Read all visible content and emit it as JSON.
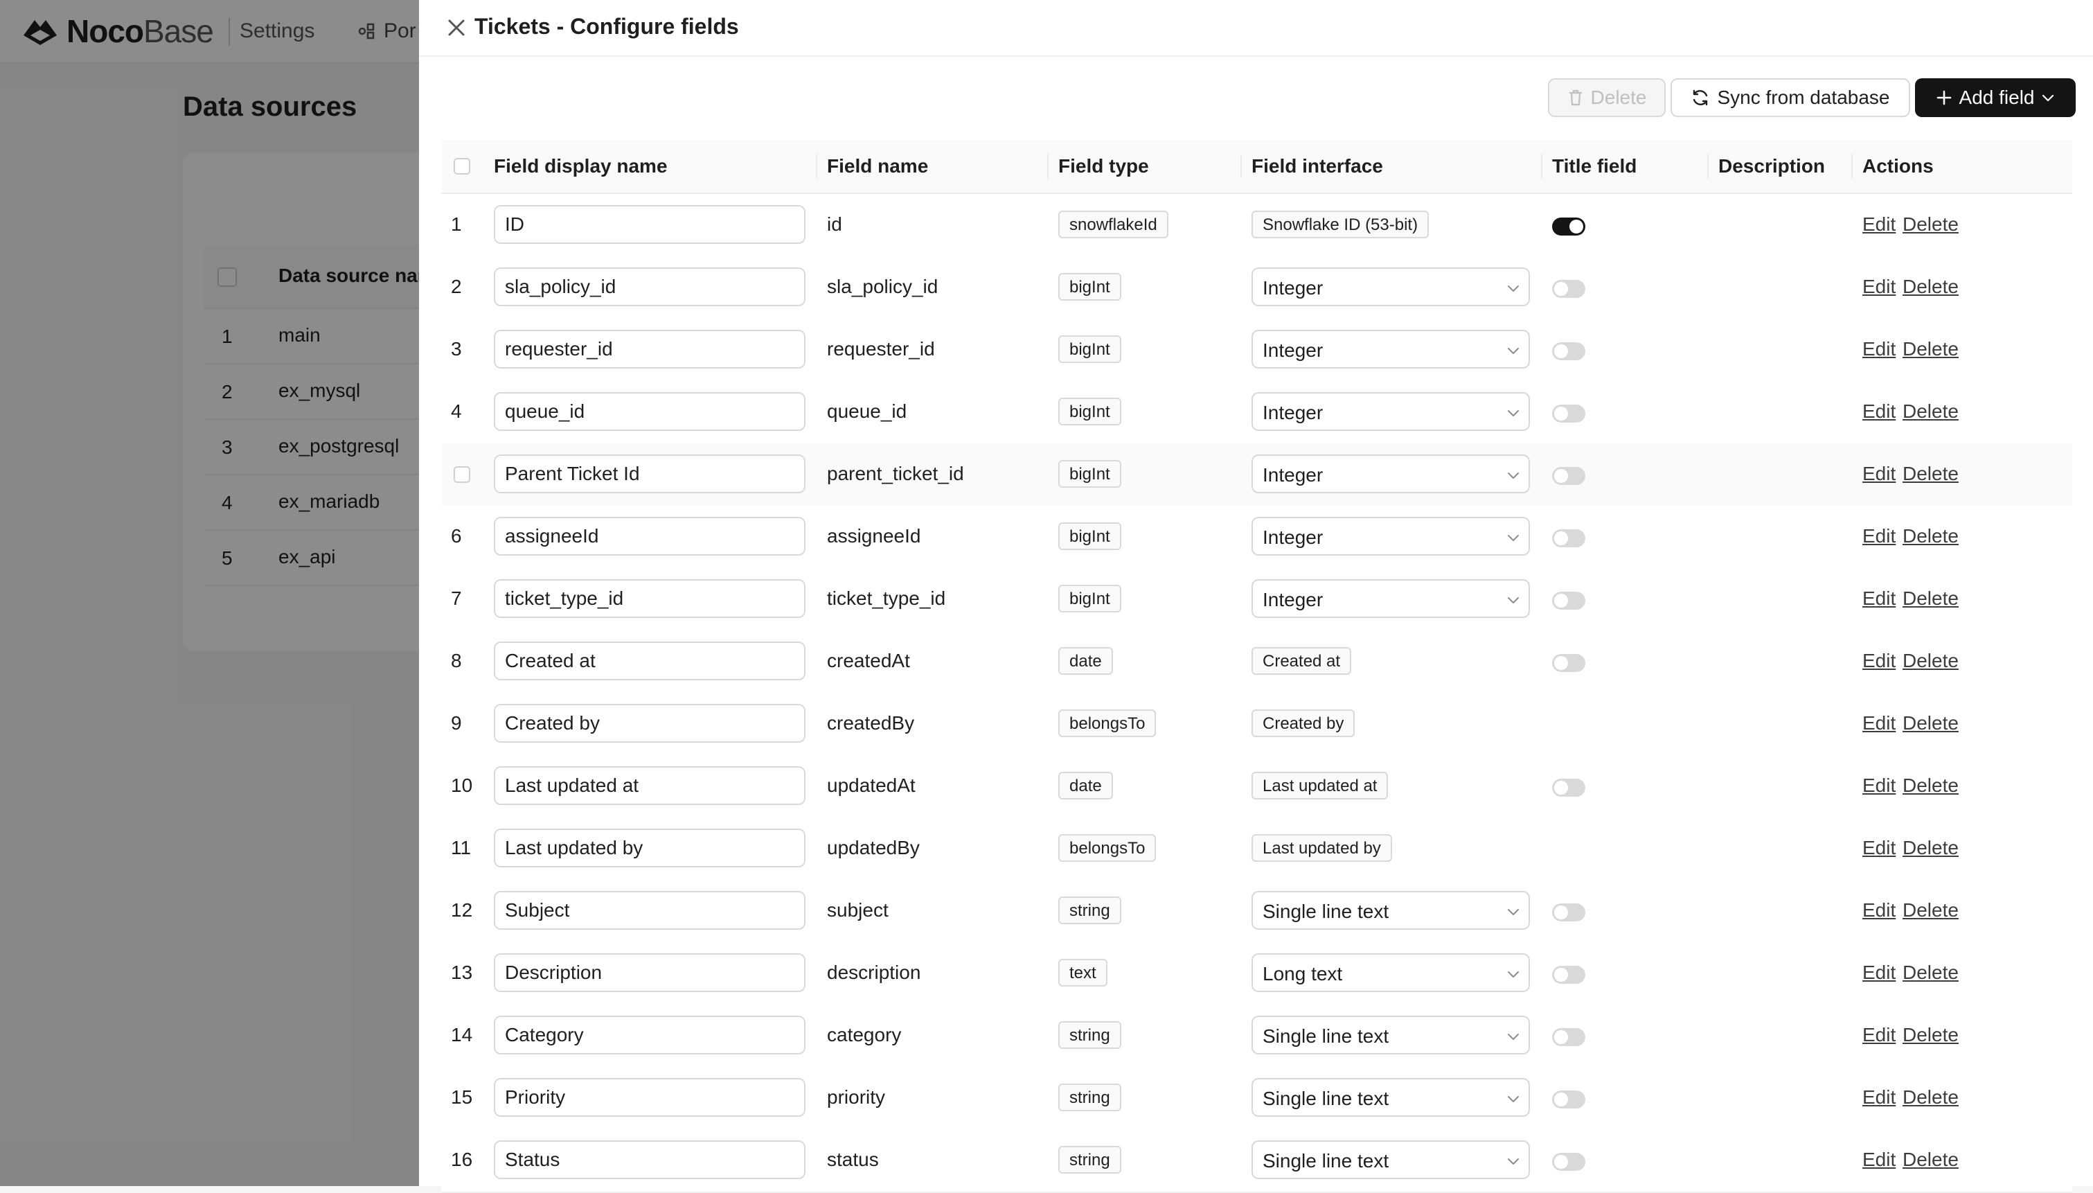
{
  "app": {
    "brand_bold": "Noco",
    "brand_light": "Base",
    "settings": "Settings",
    "nav_partial": "Por"
  },
  "background": {
    "title": "Data sources",
    "column": "Data source name",
    "rows": [
      {
        "n": "1",
        "name": "main"
      },
      {
        "n": "2",
        "name": "ex_mysql"
      },
      {
        "n": "3",
        "name": "ex_postgresql"
      },
      {
        "n": "4",
        "name": "ex_mariadb"
      },
      {
        "n": "5",
        "name": "ex_api"
      }
    ]
  },
  "drawer": {
    "title": "Tickets - Configure fields",
    "delete_label": "Delete",
    "sync_label": "Sync from database",
    "add_label": "Add field"
  },
  "table": {
    "headers": {
      "display_name": "Field display name",
      "field_name": "Field name",
      "field_type": "Field type",
      "field_interface": "Field interface",
      "title_field": "Title field",
      "description": "Description",
      "actions": "Actions"
    },
    "edit_label": "Edit",
    "delete_label": "Delete",
    "rows": [
      {
        "n": "1",
        "display": "ID",
        "name": "id",
        "type": "snowflakeId",
        "iface": "Snowflake ID (53-bit)",
        "iface_select": false,
        "title": "on"
      },
      {
        "n": "2",
        "display": "sla_policy_id",
        "name": "sla_policy_id",
        "type": "bigInt",
        "iface": "Integer",
        "iface_select": true,
        "title": "off"
      },
      {
        "n": "3",
        "display": "requester_id",
        "name": "requester_id",
        "type": "bigInt",
        "iface": "Integer",
        "iface_select": true,
        "title": "off"
      },
      {
        "n": "4",
        "display": "queue_id",
        "name": "queue_id",
        "type": "bigInt",
        "iface": "Integer",
        "iface_select": true,
        "title": "off"
      },
      {
        "n": "",
        "display": "Parent Ticket Id",
        "name": "parent_ticket_id",
        "type": "bigInt",
        "iface": "Integer",
        "iface_select": true,
        "title": "off"
      },
      {
        "n": "6",
        "display": "assigneeId",
        "name": "assigneeId",
        "type": "bigInt",
        "iface": "Integer",
        "iface_select": true,
        "title": "off"
      },
      {
        "n": "7",
        "display": "ticket_type_id",
        "name": "ticket_type_id",
        "type": "bigInt",
        "iface": "Integer",
        "iface_select": true,
        "title": "off"
      },
      {
        "n": "8",
        "display": "Created at",
        "name": "createdAt",
        "type": "date",
        "iface": "Created at",
        "iface_select": false,
        "title": "off"
      },
      {
        "n": "9",
        "display": "Created by",
        "name": "createdBy",
        "type": "belongsTo",
        "iface": "Created by",
        "iface_select": false,
        "title": "none"
      },
      {
        "n": "10",
        "display": "Last updated at",
        "name": "updatedAt",
        "type": "date",
        "iface": "Last updated at",
        "iface_select": false,
        "title": "off"
      },
      {
        "n": "11",
        "display": "Last updated by",
        "name": "updatedBy",
        "type": "belongsTo",
        "iface": "Last updated by",
        "iface_select": false,
        "title": "none"
      },
      {
        "n": "12",
        "display": "Subject",
        "name": "subject",
        "type": "string",
        "iface": "Single line text",
        "iface_select": true,
        "title": "off"
      },
      {
        "n": "13",
        "display": "Description",
        "name": "description",
        "type": "text",
        "iface": "Long text",
        "iface_select": true,
        "title": "off"
      },
      {
        "n": "14",
        "display": "Category",
        "name": "category",
        "type": "string",
        "iface": "Single line text",
        "iface_select": true,
        "title": "off"
      },
      {
        "n": "15",
        "display": "Priority",
        "name": "priority",
        "type": "string",
        "iface": "Single line text",
        "iface_select": true,
        "title": "off"
      },
      {
        "n": "16",
        "display": "Status",
        "name": "status",
        "type": "string",
        "iface": "Single line text",
        "iface_select": true,
        "title": "off"
      }
    ]
  }
}
